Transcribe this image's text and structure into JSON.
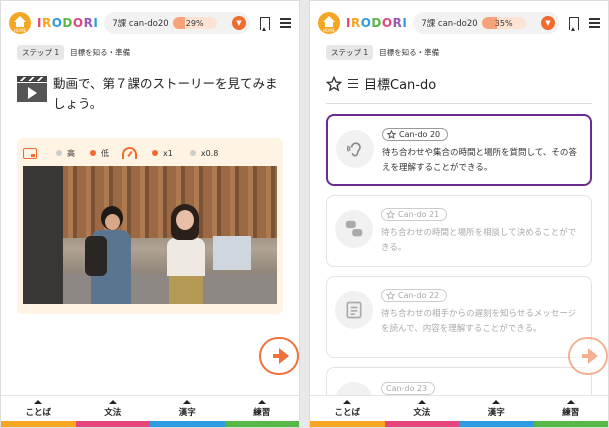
{
  "colors": {
    "accent": "#f06b2e",
    "active_border": "#6b2c91",
    "bar_colors": [
      "#f6a623",
      "#e5457b",
      "#2f9be0",
      "#58b847"
    ]
  },
  "header": {
    "home_label": "HOME",
    "logo": "IRODORI",
    "lesson": "7課 can-do20"
  },
  "screens": [
    {
      "progress": "29%",
      "progress_value": 0.29,
      "step": "ステップ 1",
      "crumb": "目標を知る・準備"
    },
    {
      "progress": "35%",
      "progress_value": 0.35,
      "step": "ステップ 1",
      "crumb": "目標を知る・準備"
    }
  ],
  "left": {
    "title": "動画で、第７課のストーリーを見てみましょう。",
    "controls": {
      "high": "高",
      "low": "低",
      "speed1": "x1",
      "speed2": "x0.8"
    }
  },
  "right": {
    "title": "目標Can-do",
    "cards": [
      {
        "tag": "Can-do 20",
        "desc": "待ち合わせや集合の時間と場所を質問して、その答えを理解することができる。",
        "icon": "ear-icon"
      },
      {
        "tag": "Can-do 21",
        "desc": "待ち合わせの時間と場所を相談して決めることができる。",
        "icon": "chat-icon"
      },
      {
        "tag": "Can-do 22",
        "desc": "待ち合わせの相手からの遅刻を知らせるメッセージを読んで、内容を理解することができる。",
        "icon": "message-icon"
      },
      {
        "tag": "Can-do 23",
        "desc": "",
        "icon": "star-icon"
      }
    ]
  },
  "nav": {
    "items": [
      "ことば",
      "文法",
      "漢字",
      "練習"
    ]
  }
}
